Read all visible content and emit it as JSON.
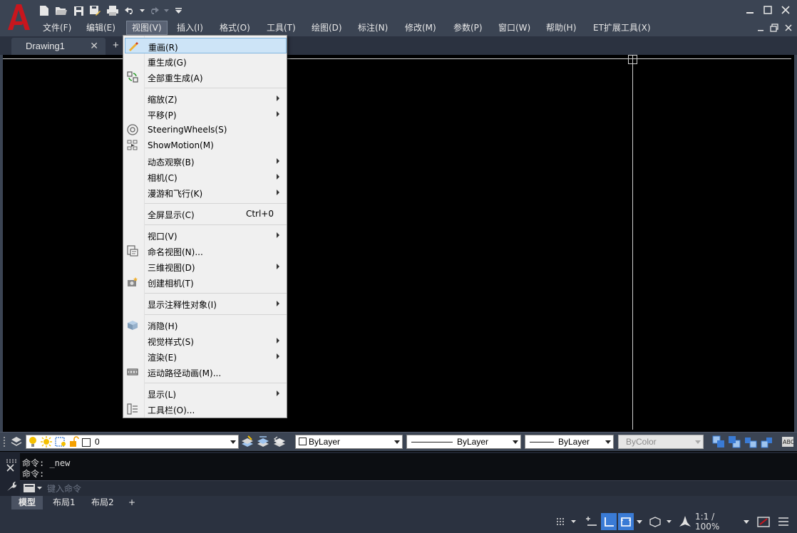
{
  "window": {
    "app_logo": "A",
    "drawing_tab": "Drawing1",
    "tab_close": "✕",
    "tab_plus": "+"
  },
  "quick_access": {
    "icons": [
      "new-icon",
      "open-icon",
      "save-icon",
      "save-as-icon",
      "plot-icon",
      "undo-icon",
      "redo-icon",
      "customize-icon"
    ]
  },
  "menubar": {
    "items": [
      "文件(F)",
      "编辑(E)",
      "视图(V)",
      "插入(I)",
      "格式(O)",
      "工具(T)",
      "绘图(D)",
      "标注(N)",
      "修改(M)",
      "参数(P)",
      "窗口(W)",
      "帮助(H)",
      "ET扩展工具(X)"
    ],
    "active": "视图(V)"
  },
  "view_menu": {
    "items": [
      {
        "label": "重画(R)",
        "icon": "redraw-icon",
        "highlighted": true
      },
      {
        "label": "重生成(G)"
      },
      {
        "label": "全部重生成(A)",
        "icon": "regen-all-icon"
      },
      {
        "label": "缩放(Z)",
        "submenu": true
      },
      {
        "label": "平移(P)",
        "submenu": true
      },
      {
        "label": "SteeringWheels(S)",
        "icon": "steering-wheels-icon"
      },
      {
        "label": "ShowMotion(M)",
        "icon": "showmotion-icon"
      },
      {
        "label": "动态观察(B)",
        "submenu": true
      },
      {
        "label": "相机(C)",
        "submenu": true
      },
      {
        "label": "漫游和飞行(K)",
        "submenu": true
      },
      {
        "label": "全屏显示(C)",
        "shortcut": "Ctrl+0"
      },
      {
        "label": "视口(V)",
        "submenu": true
      },
      {
        "label": "命名视图(N)...",
        "icon": "named-view-icon"
      },
      {
        "label": "三维视图(D)",
        "submenu": true
      },
      {
        "label": "创建相机(T)",
        "icon": "create-camera-icon"
      },
      {
        "label": "显示注释性对象(I)",
        "submenu": true
      },
      {
        "label": "消隐(H)",
        "icon": "hide-icon"
      },
      {
        "label": "视觉样式(S)",
        "submenu": true
      },
      {
        "label": "渲染(E)",
        "submenu": true
      },
      {
        "label": "运动路径动画(M)...",
        "icon": "motion-path-icon"
      },
      {
        "label": "显示(L)",
        "submenu": true
      },
      {
        "label": "工具栏(O)...",
        "icon": "toolbars-icon"
      }
    ]
  },
  "layer_bar": {
    "layer_value": "0",
    "color_value": "ByLayer",
    "linetype_value": "ByLayer",
    "lineweight_value": "ByLayer",
    "plotstyle_value": "ByColor"
  },
  "command": {
    "history": [
      "命令: _new",
      "命令:"
    ],
    "placeholder": "键入命令"
  },
  "layout_tabs": {
    "items": [
      "模型",
      "布局1",
      "布局2"
    ],
    "active": "模型",
    "plus": "+"
  },
  "status": {
    "scale": "1:1 / 100%"
  },
  "colors": {
    "chrome": "#3b4453",
    "dark_chrome": "#2b3240",
    "canvas": "#000000",
    "menu_bg": "#f0f0f0",
    "menu_highlight": "#cde4f7",
    "logo_red": "#c8161d",
    "status_active": "#3a7bd5"
  }
}
